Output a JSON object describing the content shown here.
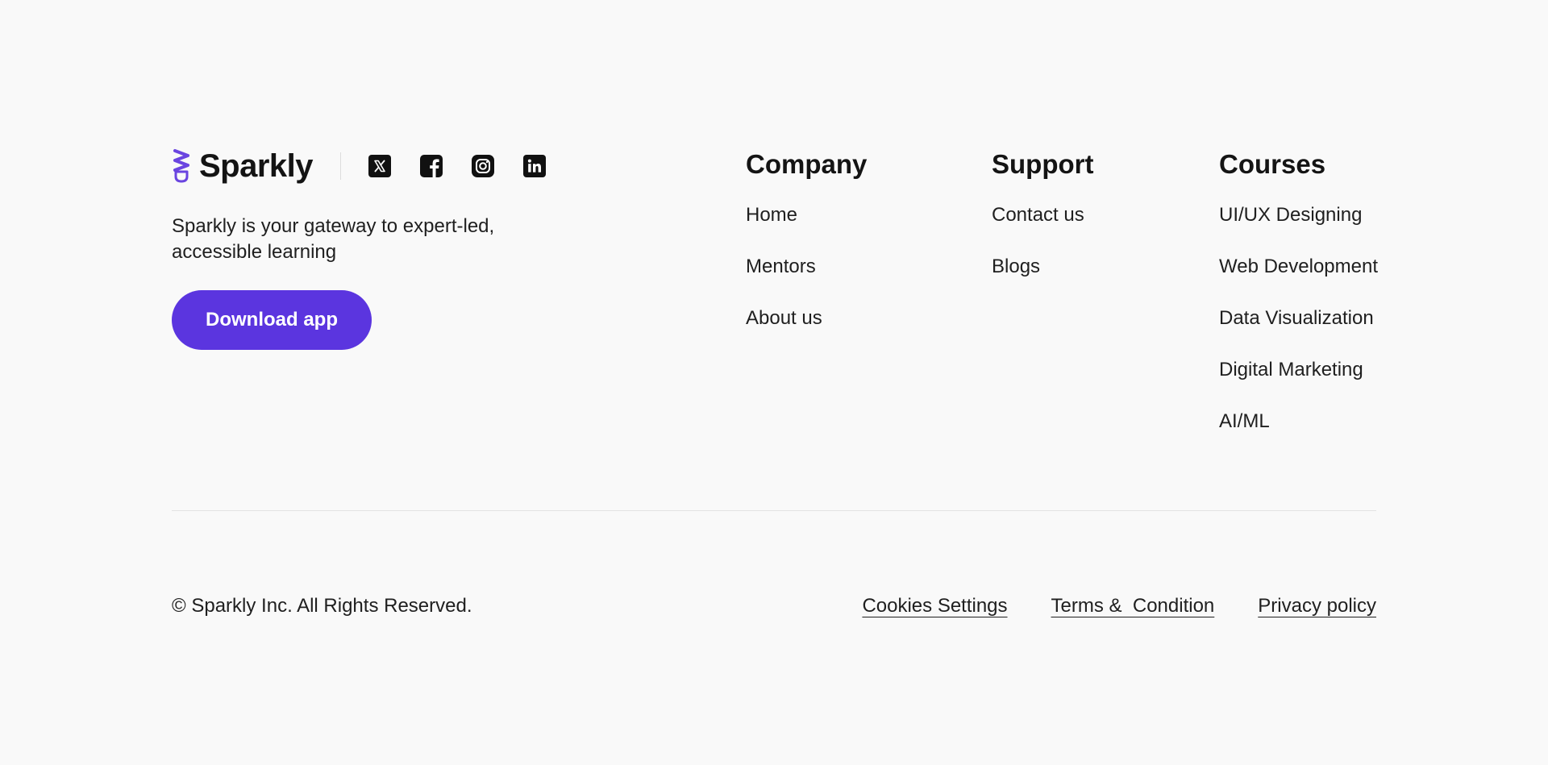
{
  "colors": {
    "background": "#f9f9f9",
    "brand_purple": "#5b35df",
    "logo_purple": "#6a45e0",
    "text": "#141414",
    "divider": "#e3e3e3"
  },
  "brand": {
    "name": "Sparkly",
    "logo_icon": "lightbulb-icon",
    "tagline": "Sparkly is your gateway to expert-led, accessible learning",
    "download_label": "Download app"
  },
  "socials": [
    {
      "icon": "x-twitter-icon"
    },
    {
      "icon": "facebook-icon"
    },
    {
      "icon": "instagram-icon"
    },
    {
      "icon": "linkedin-icon"
    }
  ],
  "columns": {
    "company": {
      "title": "Company",
      "links": [
        "Home",
        "Mentors",
        "About us"
      ]
    },
    "support": {
      "title": "Support",
      "links": [
        "Contact us",
        "Blogs"
      ]
    },
    "courses": {
      "title": "Courses",
      "links": [
        "UI/UX Designing",
        "Web Development",
        "Data Visualization",
        "Digital Marketing",
        "AI/ML"
      ]
    }
  },
  "bottom": {
    "copyright": "© Sparkly Inc. All Rights Reserved.",
    "links": [
      "Cookies Settings",
      "Terms &  Condition",
      "Privacy policy"
    ]
  }
}
